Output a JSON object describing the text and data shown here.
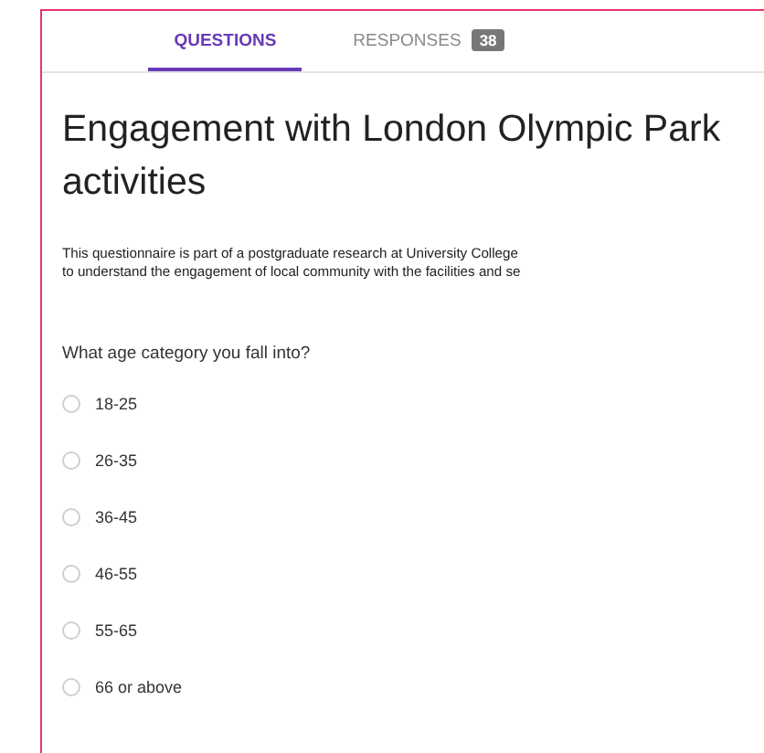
{
  "tabs": [
    {
      "label": "QUESTIONS",
      "selected": true
    },
    {
      "label": "RESPONSES",
      "selected": false,
      "badge": "38"
    }
  ],
  "form": {
    "title": "Engagement with London Olympic Park activities",
    "description": [
      "This questionnaire is part of a postgraduate research at University College",
      "to understand the engagement of local community with the facilities and se"
    ],
    "question": "What age category you fall into?",
    "options": [
      {
        "label": "18-25",
        "selected": false
      },
      {
        "label": "26-35",
        "selected": false
      },
      {
        "label": "36-45",
        "selected": false
      },
      {
        "label": "46-55",
        "selected": false
      },
      {
        "label": "55-65",
        "selected": false
      },
      {
        "label": "66 or above",
        "selected": false
      }
    ]
  }
}
